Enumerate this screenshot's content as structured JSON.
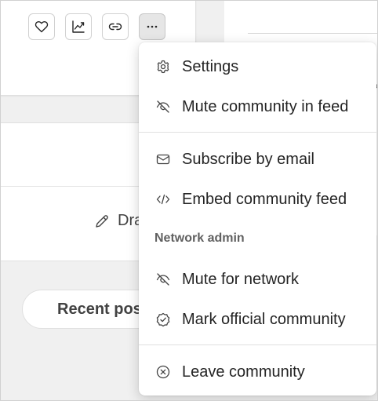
{
  "background": {
    "draft_label": "Dra",
    "recent_posts_label": "Recent pos"
  },
  "toolbar": {
    "favorite_icon": "heart-icon",
    "analytics_icon": "trend-chart-icon",
    "link_icon": "link-icon",
    "more_icon": "more-horizontal-icon"
  },
  "menu": {
    "items": [
      {
        "label": "Settings",
        "icon": "gear-icon"
      },
      {
        "label": "Mute community in feed",
        "icon": "eye-off-icon"
      },
      {
        "label": "Subscribe by email",
        "icon": "mail-icon"
      },
      {
        "label": "Embed community feed",
        "icon": "code-icon"
      },
      {
        "label": "Mute for network",
        "icon": "eye-off-icon"
      },
      {
        "label": "Mark official community",
        "icon": "badge-check-icon"
      },
      {
        "label": "Leave community",
        "icon": "dismiss-circle-icon"
      }
    ],
    "section_network_admin": "Network admin"
  }
}
